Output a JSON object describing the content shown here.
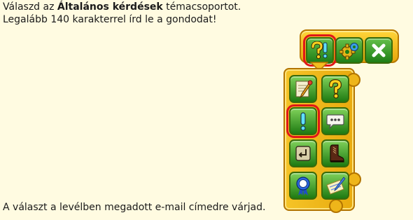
{
  "instructions": {
    "line1_prefix": "Válaszd az ",
    "line1_bold": "Általános kérdések",
    "line1_suffix": " témacsoportot.",
    "line2": "Legalább 140 karakterrel írd le a gondodat!"
  },
  "footer": {
    "line3": "A választ a levélben megadott e-mail címedre várjad."
  },
  "colors": {
    "background": "#fffbe1",
    "frame": "#e8aa0e",
    "button": "#1f7d16",
    "selection": "#e01818"
  },
  "toolbar": {
    "buttons": [
      {
        "icon": "question-exclamation-icon",
        "selected": true
      },
      {
        "icon": "gear-icon",
        "selected": false
      },
      {
        "icon": "close-icon",
        "selected": false
      }
    ]
  },
  "menu": {
    "items": [
      {
        "icon": "pencil-paper-icon",
        "selected": false
      },
      {
        "icon": "question-mark-icon",
        "selected": false
      },
      {
        "icon": "exclamation-icon",
        "selected": true
      },
      {
        "icon": "speech-bubble-icon",
        "selected": false
      },
      {
        "icon": "return-key-icon",
        "selected": false
      },
      {
        "icon": "boot-icon",
        "selected": false
      },
      {
        "icon": "award-ribbon-icon",
        "selected": false
      },
      {
        "icon": "ticket-pen-icon",
        "selected": false
      }
    ]
  }
}
